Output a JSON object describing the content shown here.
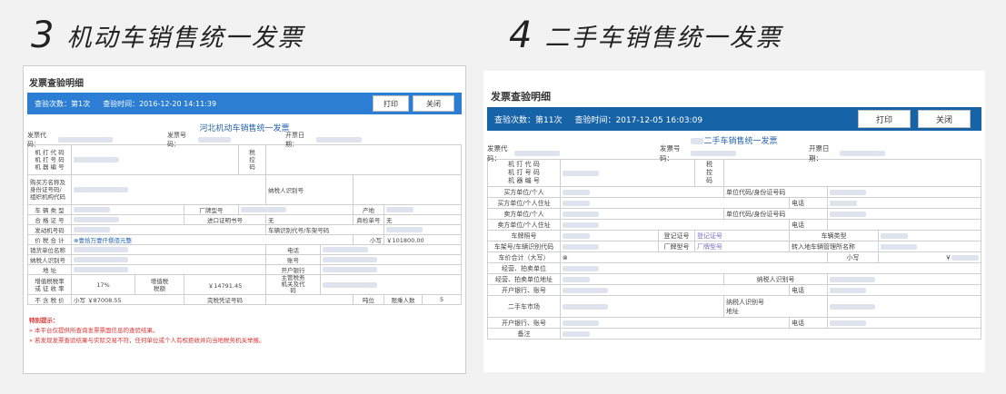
{
  "headings": {
    "left": {
      "num": "3",
      "text": "机动车销售统一发票"
    },
    "right": {
      "num": "4",
      "text": "二手车销售统一发票"
    }
  },
  "left_panel": {
    "title": "发票查验明细",
    "check_count": "查验次数：第1次",
    "check_time": "查验时间：2016-12-20 14:11:39",
    "print": "打印",
    "close": "关闭",
    "invoice_title": "河北机动车销售统一发票",
    "hdr": {
      "code": "发票代码：",
      "number": "发票号码：",
      "date": "开票日期："
    },
    "rows": {
      "machine_codes": "机 打 代 码\n机 打 号 码\n机 器 编 号",
      "tax_ctrl": "税\n控\n码",
      "buyer": "购买方名称及\n身份证号码/\n组织机构代码",
      "taxpayer_id": "纳税人识别号",
      "vehicle_type": "车 辆 类 型",
      "brand_model": "厂牌型号",
      "origin": "产地",
      "cert_no": "合 格 证 号",
      "import_cert": "进口证明书号",
      "none1": "无",
      "inspection_no": "商检单号",
      "none2": "无",
      "engine_no": "发动机号码",
      "vin": "车辆识别代号/车架号码",
      "total_label": "价 税 合 计",
      "total_words": "⊗壹拾万壹仟捌佰元整",
      "small": "小写",
      "total_num": "￥101800.00",
      "seller": "销货单位名称",
      "phone": "电话",
      "seller_tax": "纳税人识别号",
      "account": "账号",
      "address": "地  址",
      "bank": "开户银行",
      "vat_rate": "增值税税率\n或 征 收 率",
      "rate_val": "17%",
      "vat_amount": "增值税\n税额",
      "vat_val": "￥14791.45",
      "tax_authority": "主管税务\n机关及代\n码",
      "pre_tax": "不 含 税 价",
      "pre_tax_val": "小写 ￥87008.55",
      "tax_cert": "完税凭证号码",
      "tonnage": "吨位",
      "seats": "限乘人数",
      "seats_val": "5"
    },
    "notes": {
      "title": "特别提示：",
      "line1": "» 本平台仅提供所查询发票票面信息的查验结果。",
      "line2": "» 若发现发票查验结果与实际交易不符，任何单位或个人有权拒收并向当地税务机关举报。"
    }
  },
  "right_panel": {
    "title": "发票查验明细",
    "check_count": "查验次数：第11次",
    "check_time": "查验时间：2017-12-05 16:03:09",
    "print": "打印",
    "close": "关闭",
    "invoice_title": "二手车销售统一发票",
    "hdr": {
      "code": "发票代码：",
      "number": "发票号码：",
      "date": "开票日期："
    },
    "rows": {
      "machine_codes": "机 打 代 码\n机 打 号 码\n机 器 编 号",
      "tax_ctrl": "税\n控\n码",
      "buyer": "买方单位/个人",
      "buyer_code": "单位代码/身份证号码",
      "buyer_addr": "买方单位/个人住址",
      "phone": "电话",
      "seller": "卖方单位/个人",
      "seller_code": "单位代码/身份证号码",
      "seller_addr": "卖方单位/个人住址",
      "plate": "车牌照号",
      "reg_no": "登记证号",
      "reg_val": "登记证号",
      "vehicle_type": "车辆类型",
      "vin": "车架号/车辆识别代码",
      "brand": "厂牌型号",
      "brand_val": "厂牌型号",
      "transfer_office": "转入地车辆管理所名称",
      "total": "车价合计（大写）",
      "total_sym": "⊗",
      "small": "小写",
      "yen": "￥",
      "auction": "经营、拍卖单位",
      "auction_addr": "经营、拍卖单位地址",
      "taxpayer_id": "纳税人识别号",
      "bank": "开户银行、账号",
      "market": "二手车市场",
      "market_tax": "纳税人识别号",
      "market_addr": "地址",
      "bank2": "开户银行、账号",
      "phone2": "电话",
      "remark": "备注"
    }
  }
}
